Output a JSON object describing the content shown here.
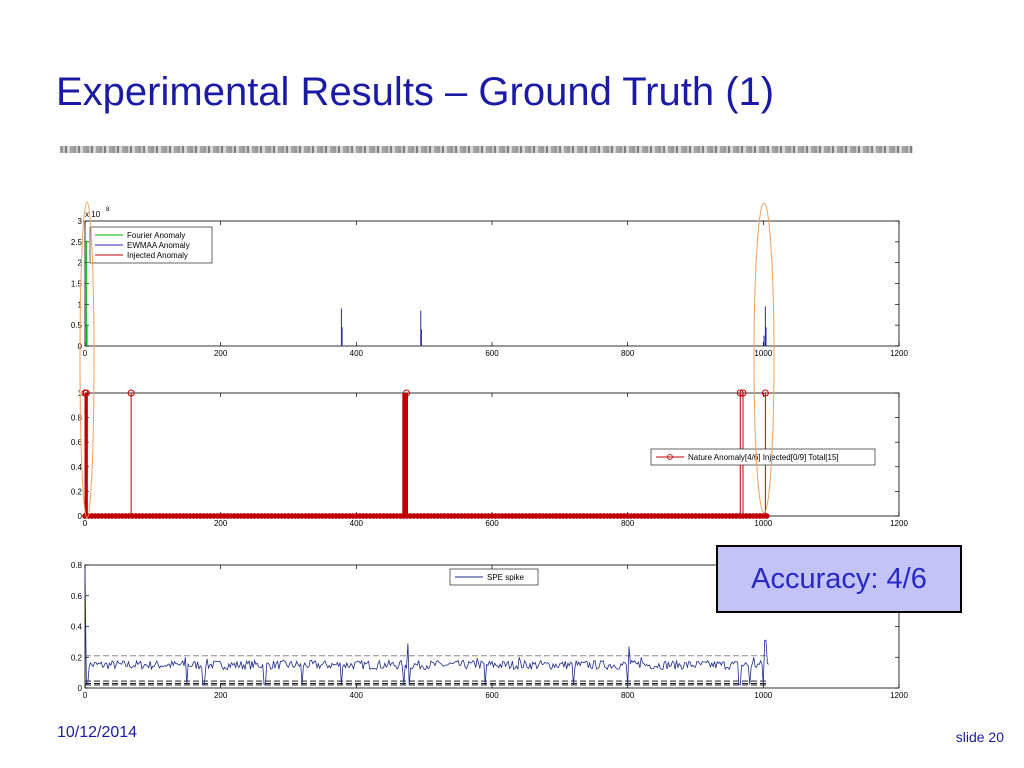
{
  "slide": {
    "title": "Experimental Results – Ground Truth (1)",
    "accuracy_text": "Accuracy: 4/6",
    "footer_date": "10/12/2014",
    "footer_slide": "slide 20"
  },
  "colors": {
    "title": "#1a1aa6",
    "fourier": "#00b000",
    "ewmaa": "#2a2aa0",
    "injected": "#c00000",
    "spe": "#1f2a8c",
    "accuracy_bg": "#c3c3f7",
    "ellipse": "#f0a060"
  },
  "chart_data": [
    {
      "type": "line",
      "exponent_label": "x 10",
      "exponent_sup": "8",
      "xlim": [
        0,
        1200
      ],
      "ylim": [
        0,
        3
      ],
      "xticks": [
        0,
        200,
        400,
        600,
        800,
        1000,
        1200
      ],
      "yticks": [
        0,
        0.5,
        1,
        1.5,
        2,
        2.5,
        3
      ],
      "legend_position": "top-left",
      "series": [
        {
          "name": "Fourier Anomaly",
          "color": "#00b000",
          "spikes": [
            [
              2,
              2.5
            ],
            [
              3,
              0.5
            ]
          ]
        },
        {
          "name": "EWMAA Anomaly",
          "color": "#2a2aa0",
          "spikes": [
            [
              378,
              0.9
            ],
            [
              379,
              0.45
            ],
            [
              495,
              0.85
            ],
            [
              496,
              0.4
            ],
            [
              1001,
              0.25
            ],
            [
              1003,
              0.95
            ],
            [
              1004,
              0.45
            ]
          ]
        },
        {
          "name": "Injected Anomaly",
          "color": "#c00000",
          "spikes": []
        }
      ]
    },
    {
      "type": "line",
      "xlim": [
        0,
        1200
      ],
      "ylim": [
        0,
        1
      ],
      "xticks": [
        0,
        200,
        400,
        600,
        800,
        1000,
        1200
      ],
      "yticks": [
        0,
        0.2,
        0.4,
        0.6,
        0.8,
        1
      ],
      "legend_position": "right",
      "series": [
        {
          "name": "Nature Anomaly[4/6] Injected[0/9] Total[15]",
          "color": "#c00000",
          "stems": [
            0,
            2,
            68,
            474,
            966,
            970,
            1003
          ]
        },
        {
          "name": "",
          "color": "#c00000",
          "thick_stems": [
            2,
            470,
            474
          ]
        }
      ]
    },
    {
      "type": "line",
      "xlim": [
        0,
        1200
      ],
      "ylim": [
        0,
        0.8
      ],
      "xticks": [
        0,
        200,
        400,
        600,
        800,
        1000,
        1200
      ],
      "yticks": [
        0,
        0.2,
        0.4,
        0.6,
        0.8
      ],
      "legend_position": "top-center",
      "thresholds": [
        0.21,
        0.045,
        0.03,
        0.02
      ],
      "series": [
        {
          "name": "SPE spike",
          "color": "#1f2a8c",
          "baseline": 0.15,
          "peaks": [
            [
              1,
              0.78
            ],
            [
              2,
              0.25
            ],
            [
              148,
              0.2
            ],
            [
              180,
              0.19
            ],
            [
              470,
              0.29
            ],
            [
              476,
              0.29
            ],
            [
              578,
              0.19
            ],
            [
              640,
              0.2
            ],
            [
              802,
              0.27
            ],
            [
              820,
              0.2
            ],
            [
              966,
              0.2
            ],
            [
              986,
              0.2
            ],
            [
              1003,
              0.31
            ]
          ],
          "dips": [
            [
              3,
              0.02
            ],
            [
              150,
              0.02
            ],
            [
              175,
              0.02
            ],
            [
              265,
              0.02
            ],
            [
              320,
              0.02
            ],
            [
              378,
              0.02
            ],
            [
              470,
              0.02
            ],
            [
              478,
              0.02
            ],
            [
              590,
              0.02
            ],
            [
              720,
              0.02
            ],
            [
              800,
              0.02
            ],
            [
              965,
              0.02
            ],
            [
              980,
              0.02
            ],
            [
              1000,
              0.02
            ]
          ]
        }
      ]
    }
  ]
}
